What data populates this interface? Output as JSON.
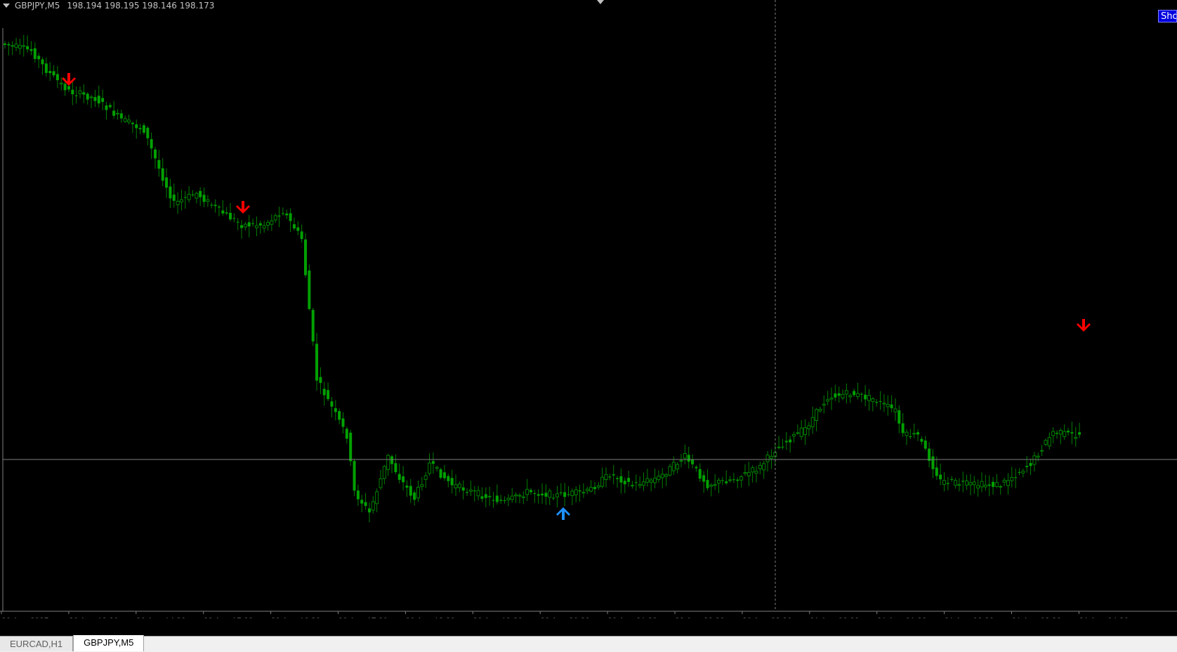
{
  "window": {
    "symbol": "GBPJPY,M5",
    "ohlc": "198.194 198.195 198.146 198.173",
    "show_button_label": "Sho"
  },
  "colors": {
    "background": "#000000",
    "candle": "#008000",
    "candle_body": "#00a000",
    "sell_arrow": "#ff0000",
    "buy_arrow": "#1e90ff",
    "price_line": "#808080",
    "time_axis_text": "#c0c0c0"
  },
  "time_axis": [
    "20 Aug 2025",
    "20 Aug 13:30",
    "20 Aug 14:30",
    "20 Aug 15:30",
    "20 Aug 16:30",
    "20 Aug 17:30",
    "20 Aug 18:30",
    "20 Aug 19:30",
    "20 Aug 20:30",
    "20 Aug 21:30",
    "20 Aug 22:30",
    "20 Aug 23:30",
    "21 Aug 00:30",
    "21 Aug 01:30",
    "21 Aug 02:30",
    "21 Aug 03:30",
    "21 Aug 04:30"
  ],
  "signals": [
    {
      "type": "sell",
      "icon": "down-arrow-icon",
      "bar": 18
    },
    {
      "type": "sell",
      "icon": "down-arrow-icon",
      "bar": 64
    },
    {
      "type": "buy",
      "icon": "up-arrow-icon",
      "bar": 149
    },
    {
      "type": "sell",
      "icon": "down-arrow-icon",
      "bar": 288
    }
  ],
  "tabs": [
    {
      "label": "EURCAD,H1",
      "active": false
    },
    {
      "label": "GBPJPY,M5",
      "active": true
    }
  ]
}
